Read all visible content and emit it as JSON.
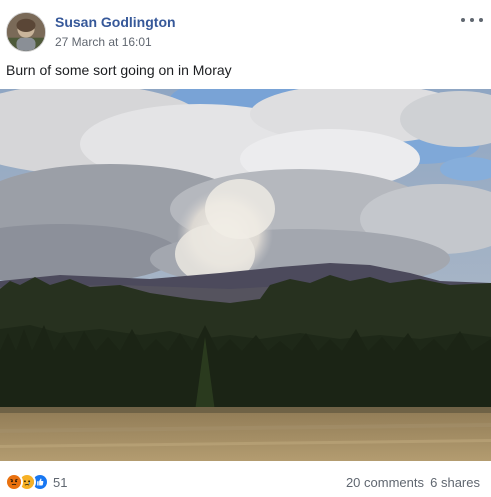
{
  "post": {
    "author": "Susan Godlington",
    "timestamp": "27 March at 16:01",
    "text": "Burn of some sort going on in Moray",
    "photo_alt": "",
    "more_options_icon": "more-horizontal-icon"
  },
  "footer": {
    "reactions": [
      "angry-reaction-icon",
      "sad-reaction-icon",
      "like-reaction-icon"
    ],
    "reaction_count": "51",
    "comments": "20 comments",
    "shares": "6 shares"
  },
  "colors": {
    "author_link": "#365899",
    "secondary_text": "#616770",
    "like_blue": "#1877f2",
    "angry_orange": "#e9710f",
    "sad_yellow": "#f7b125"
  }
}
